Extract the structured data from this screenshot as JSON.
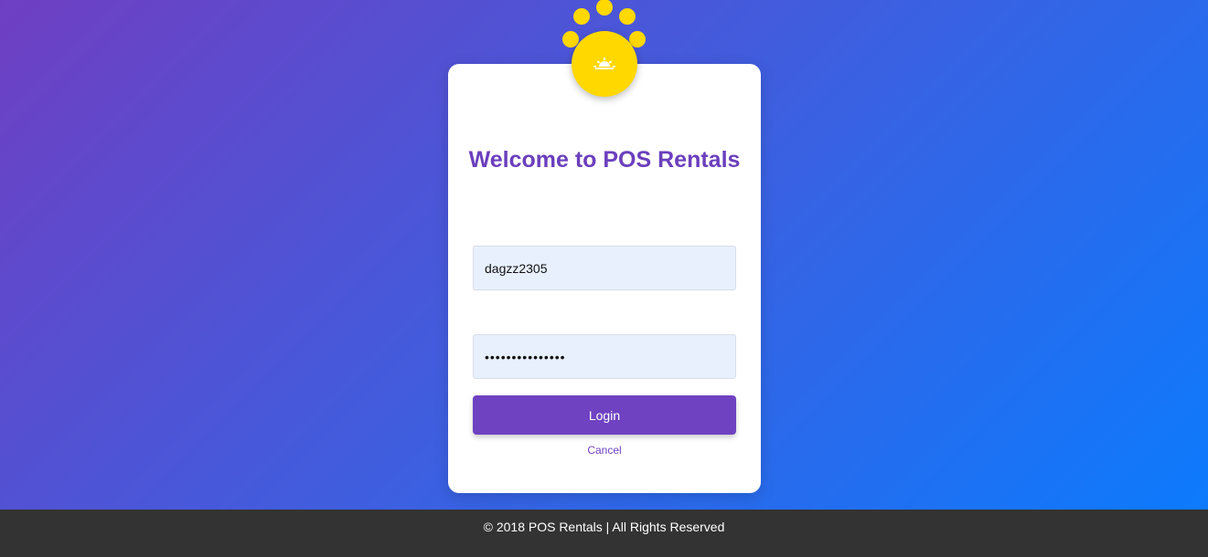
{
  "login": {
    "title": "Welcome to POS Rentals",
    "username_value": "dagzz2305",
    "password_value": "•••••••••••••••",
    "login_label": "Login",
    "cancel_label": "Cancel"
  },
  "logo": {
    "icon": "sunrise-icon",
    "color": "#ffd800"
  },
  "footer": {
    "text": "© 2018 POS Rentals | All Rights Reserved"
  },
  "colors": {
    "accent": "#6f42c1",
    "input_bg": "#e8f0fe",
    "footer_bg": "#333333"
  }
}
